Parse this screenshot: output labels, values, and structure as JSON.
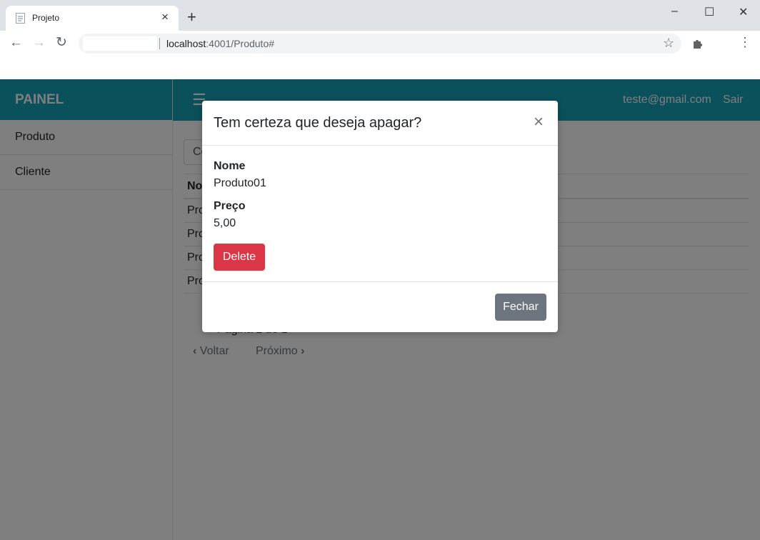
{
  "browser": {
    "tab_title": "Projeto",
    "tab_close": "×",
    "new_tab": "+",
    "url_host": "localhost",
    "url_path": ":4001/Produto#",
    "window_controls": {
      "minimize": "–",
      "maximize": "☐",
      "close": "✕"
    }
  },
  "sidebar": {
    "brand": "PAINEL",
    "items": [
      {
        "label": "Produto"
      },
      {
        "label": "Cliente"
      }
    ]
  },
  "topbar": {
    "menu_icon": "☰",
    "user_email": "teste@gmail.com",
    "logout_label": "Sair"
  },
  "main": {
    "search_text": "Co",
    "table_header": "No",
    "rows": [
      "Pro",
      "Pro",
      "Pro",
      "Pro"
    ],
    "page_info": "Página 1 de 1",
    "prev_label": "Voltar",
    "next_label": "Próximo"
  },
  "modal": {
    "title": "Tem certeza que deseja apagar?",
    "close_icon": "×",
    "name_label": "Nome",
    "name_value": "Produto01",
    "price_label": "Preço",
    "price_value": "5,00",
    "delete_label": "Delete",
    "close_label": "Fechar"
  },
  "colors": {
    "brand": "#17a2b8",
    "danger": "#dc3545",
    "secondary": "#6c757d",
    "overlay": "rgba(0,0,0,0.5)"
  }
}
